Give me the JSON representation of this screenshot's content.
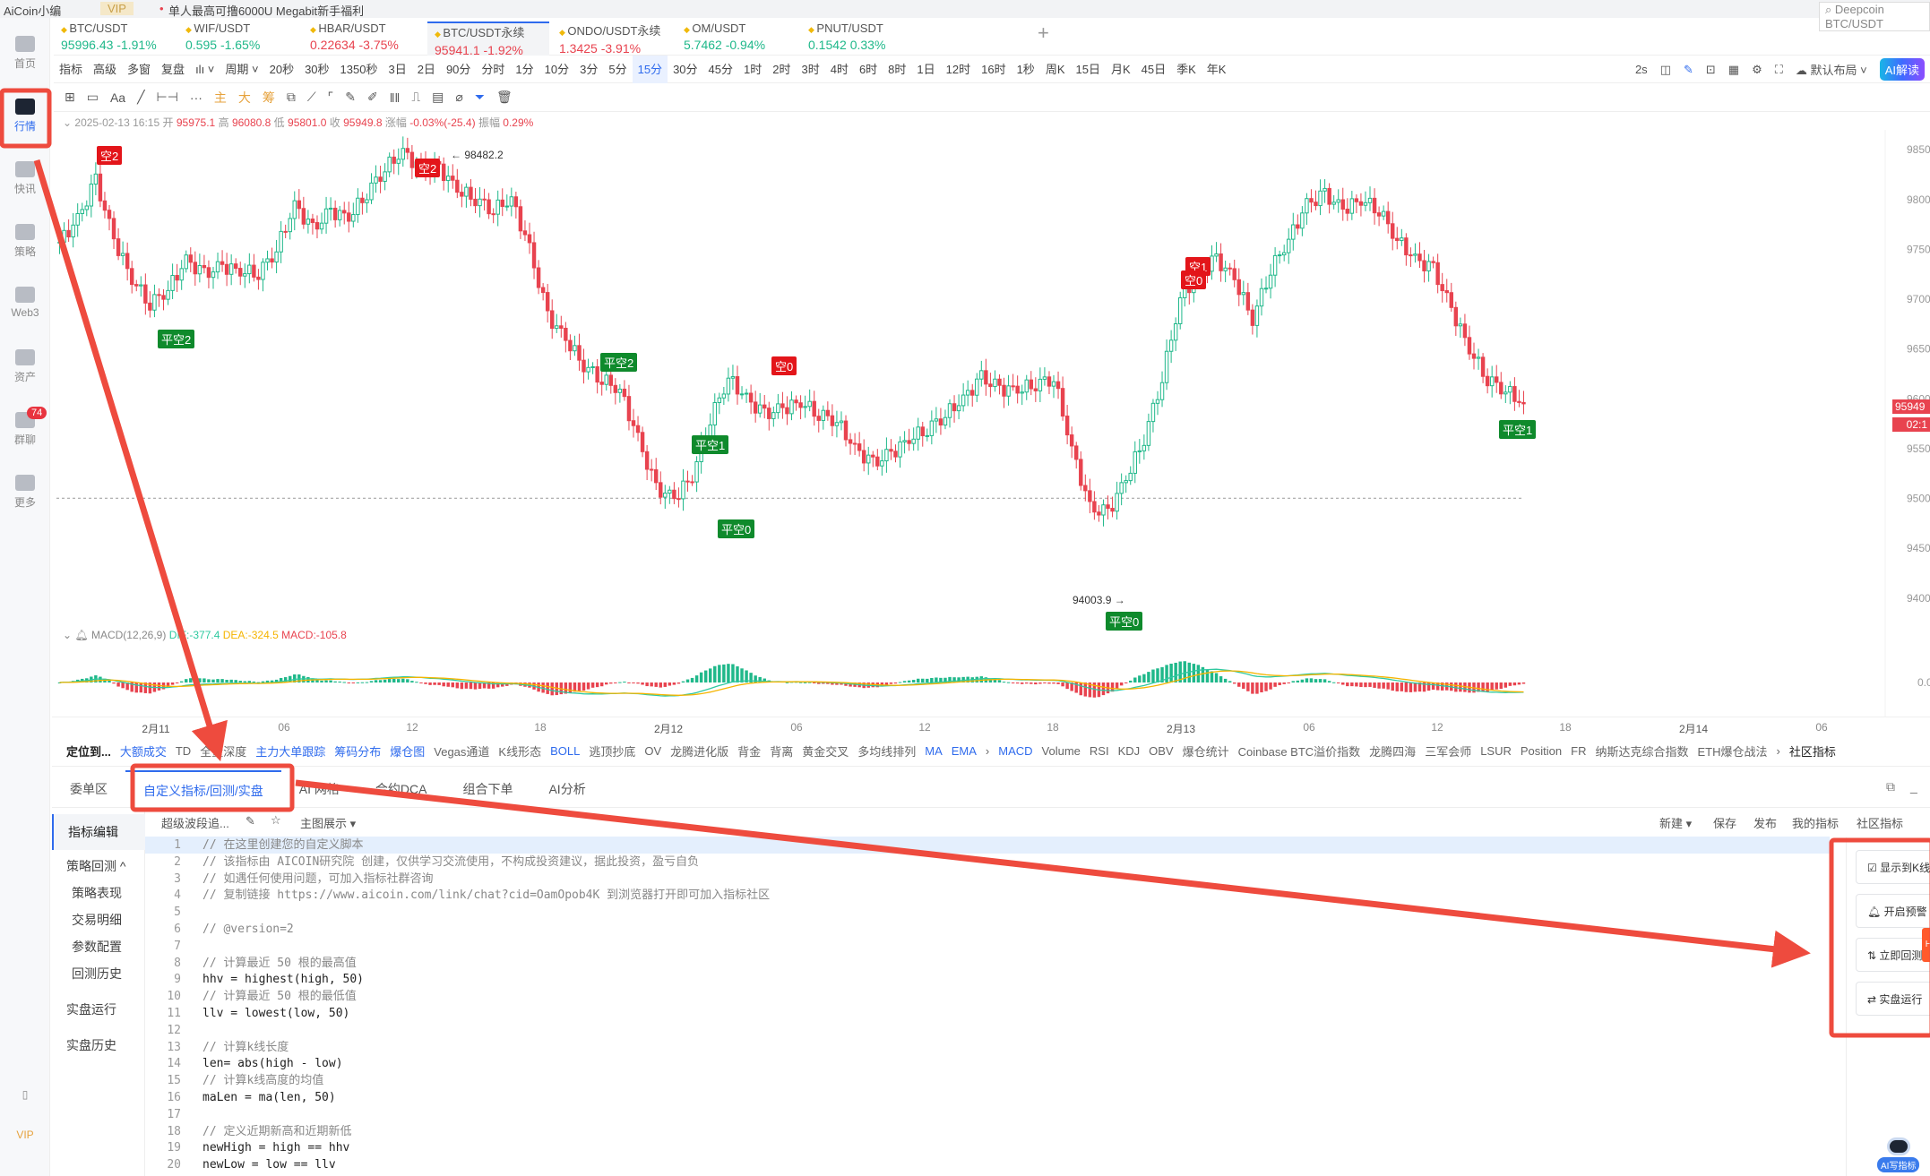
{
  "topbar": {
    "app_name": "AiCoin小编",
    "vip": "VIP",
    "promo": "单人最高可撸6000U Megabit新手福利",
    "search_placeholder": "Deepcoin BTC/USDT"
  },
  "sidebar": {
    "items": [
      {
        "label": "首页",
        "icon": "home-icon"
      },
      {
        "label": "行情",
        "icon": "market-chart-icon",
        "active": true
      },
      {
        "label": "快讯",
        "icon": "news-icon"
      },
      {
        "label": "策略",
        "icon": "robot-icon"
      },
      {
        "label": "Web3",
        "icon": "web3-icon"
      },
      {
        "label": "资产",
        "icon": "wallet-icon"
      },
      {
        "label": "群聊",
        "icon": "chat-icon",
        "badge": "74"
      },
      {
        "label": "更多",
        "icon": "grid-icon"
      }
    ],
    "bottom": {
      "vip": "VIP"
    }
  },
  "tickers": [
    {
      "name": "BTC/USDT",
      "price": "95996.43",
      "change": "-1.91%",
      "color": "up"
    },
    {
      "name": "WIF/USDT",
      "price": "0.595",
      "change": "-1.65%",
      "color": "up"
    },
    {
      "name": "HBAR/USDT",
      "price": "0.22634",
      "change": "-3.75%",
      "color": "dn"
    },
    {
      "name": "BTC/USDT永续",
      "price": "95941.1",
      "change": "-1.92%",
      "color": "dn",
      "active": true
    },
    {
      "name": "ONDO/USDT永续",
      "price": "1.3425",
      "change": "-3.91%",
      "color": "dn"
    },
    {
      "name": "OM/USDT",
      "price": "5.7462",
      "change": "-0.94%",
      "color": "up"
    },
    {
      "name": "PNUT/USDT",
      "price": "0.1542",
      "change": "0.33%",
      "color": "up"
    }
  ],
  "add_tab": "+",
  "periods": [
    "指标",
    "高级",
    "多窗",
    "复盘",
    "ılı ˅",
    "周期 ˅",
    "20秒",
    "30秒",
    "1350秒",
    "3日",
    "2日",
    "90分",
    "分时",
    "1分",
    "10分",
    "3分",
    "5分",
    "15分",
    "30分",
    "45分",
    "1时",
    "2时",
    "3时",
    "4时",
    "6时",
    "8时",
    "1日",
    "12时",
    "16时",
    "1秒",
    "周K",
    "15日",
    "月K",
    "45日",
    "季K",
    "年K"
  ],
  "active_period": "15分",
  "period_right": {
    "refresh": "2s",
    "layout": "默认布局 ˅",
    "ai": "AI解读"
  },
  "tools": [
    "⊞",
    "▭",
    "Aa",
    "╱",
    "⊢⊣",
    "···",
    "主",
    "大",
    "筹",
    "⧉",
    "⟋",
    "⌜",
    "✎",
    "✐",
    "‖‖",
    "⎍",
    "▤",
    "⌀",
    "⏷",
    "🗑"
  ],
  "info": {
    "datetime": "2025-02-13 16:15",
    "open_label": "开",
    "open": "95975.1",
    "high_label": "高",
    "high": "96080.8",
    "low_label": "低",
    "low": "95801.0",
    "close_label": "收",
    "close": "95949.8",
    "chg_label": "涨幅",
    "chg": "-0.03%(-25.4)",
    "amp_label": "振幅",
    "amp": "0.29%"
  },
  "chart_data": {
    "type": "candlestick",
    "interval": "15分",
    "price_ticks": [
      "98500",
      "98000",
      "97500",
      "97000",
      "96500",
      "96000",
      "95500",
      "95000",
      "94500",
      "94000"
    ],
    "price_range": [
      93800,
      98700
    ],
    "time_ticks": [
      "2月11",
      "06",
      "12",
      "18",
      "2月12",
      "06",
      "12",
      "18",
      "2月13",
      "06",
      "12",
      "18",
      "2月14",
      "06"
    ],
    "closes_hourly": [
      97573,
      97800,
      98194,
      97600,
      97204,
      96956,
      97100,
      97392,
      97250,
      97330,
      97280,
      97267,
      97500,
      97946,
      97700,
      97883,
      97820,
      98069,
      98315,
      98482,
      98300,
      98315,
      98100,
      98008,
      97900,
      98008,
      97500,
      96833,
      96600,
      96337,
      96200,
      96090,
      95600,
      95100,
      95000,
      95226,
      95800,
      96213,
      96000,
      95842,
      95900,
      95966,
      95850,
      95780,
      95500,
      95348,
      95450,
      95595,
      95700,
      95842,
      96000,
      96213,
      96100,
      96090,
      96150,
      96213,
      95500,
      94900,
      94855,
      95200,
      95600,
      96213,
      97000,
      97267,
      97400,
      97204,
      96800,
      97300,
      97600,
      97950,
      98050,
      97900,
      98000,
      97900,
      97600,
      97400,
      97300,
      96900,
      96500,
      96200,
      96090,
      95949.8
    ],
    "high_mark": "← 98482.2",
    "low_mark": "94003.9 →",
    "last_price": "95949",
    "countdown": "02:1",
    "signals": [
      "空2",
      "平空2",
      "空2",
      "平空2",
      "空0",
      "平空1",
      "平空0",
      "平空0",
      "空1",
      "空0",
      "平空1"
    ],
    "macd": {
      "label": "MACD(12,26,9)",
      "dif": "DIF:-377.4",
      "dea": "DEA:-324.5",
      "macd": "MACD:-105.8",
      "zero_tick": "0.0"
    },
    "colors": {
      "up": "#1fb88a",
      "down": "#e8434f",
      "dif": "#2fc9a0",
      "dea": "#f5b400"
    }
  },
  "indicator_bar": {
    "locate": "定位到...",
    "items": [
      "大额成交",
      "TD",
      "全量深度",
      "主力大单跟踪",
      "筹码分布",
      "爆仓图",
      "Vegas通道",
      "K线形态",
      "BOLL",
      "逃顶抄底",
      "OV",
      "龙腾进化版",
      "背金",
      "背离",
      "黄金交叉",
      "多均线排列",
      "MA",
      "EMA",
      "›",
      "MACD",
      "Volume",
      "RSI",
      "KDJ",
      "OBV",
      "爆仓统计",
      "Coinbase BTC溢价指数",
      "龙腾四海",
      "三军会师",
      "LSUR",
      "Position",
      "FR",
      "纳斯达克综合指数",
      "ETH爆仓战法",
      "›"
    ],
    "community": "社区指标"
  },
  "bottom_tabs": [
    "委单区",
    "自定义指标/回测/实盘",
    "AI 网格",
    "合约DCA",
    "组合下单",
    "AI分析"
  ],
  "left_nav": {
    "editor": "指标编辑",
    "backtest": "策略回测 ^",
    "sub": [
      "策略表现",
      "交易明细",
      "参数配置",
      "回测历史"
    ],
    "live": "实盘运行",
    "live_history": "实盘历史"
  },
  "editor_toolbar": {
    "script_name": "超级波段追...",
    "view": "主图展示 ▾",
    "new": "新建 ▾",
    "save": "保存",
    "publish": "发布",
    "mine": "我的指标",
    "community": "社区指标"
  },
  "code_lines": [
    "// 在这里创建您的自定义脚本",
    "// 该指标由 AICOIN研究院 创建，仅供学习交流使用，不构成投资建议，据此投资，盈亏自负",
    "// 如遇任何使用问题，可加入指标社群咨询",
    "// 复制链接 https://www.aicoin.com/link/chat?cid=OamOpob4K 到浏览器打开即可加入指标社区",
    "",
    "// @version=2",
    "",
    "// 计算最近 50 根的最高值",
    "hhv = highest(high, 50)",
    "// 计算最近 50 根的最低值",
    "llv = lowest(low, 50)",
    "",
    "// 计算k线长度",
    "len= abs(high - low)",
    "// 计算k线高度的均值",
    "maLen = ma(len, 50)",
    "",
    "// 定义近期新高和近期新低",
    "newHigh = high == hhv",
    "newLow = low == llv"
  ],
  "right_panel": {
    "show_kline": "显示到K线",
    "alert": "开启预警",
    "backtest": "立即回测",
    "hot": "H",
    "live": "实盘运行"
  },
  "ai_write": "AI写指标",
  "annotation_color": "#ee4b3e"
}
